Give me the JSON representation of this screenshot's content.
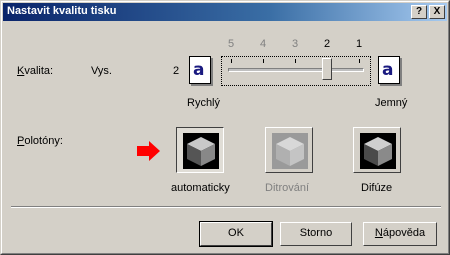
{
  "window": {
    "title": "Nastavit kvalitu tisku",
    "help_btn": "?",
    "close_btn": "X"
  },
  "quality": {
    "label_key": "K",
    "label_rest": "valita:",
    "level_text": "Vys.",
    "current_value": "2",
    "scale": [
      "5",
      "4",
      "3",
      "2",
      "1"
    ],
    "selected_index": 3,
    "left_icon_glyph": "a",
    "right_icon_glyph": "a",
    "left_caption": "Rychlý",
    "right_caption": "Jemný"
  },
  "halftones": {
    "label_key": "P",
    "label_rest": "olotóny:",
    "options": [
      {
        "label": "automaticky",
        "state": "selected",
        "icon": "cube-icon"
      },
      {
        "label": "Ditrování",
        "state": "disabled",
        "icon": "cube-icon"
      },
      {
        "label": "Difúze",
        "state": "normal",
        "icon": "cube-icon"
      }
    ],
    "pointer_icon": "red-arrow-icon",
    "pointer_color": "#ff0000"
  },
  "buttons": {
    "ok": "OK",
    "cancel": "Storno",
    "help_key": "N",
    "help_rest": "ápověda"
  },
  "colors": {
    "title_start": "#0a246a",
    "title_end": "#a6caf0",
    "face": "#d4d0c8"
  }
}
